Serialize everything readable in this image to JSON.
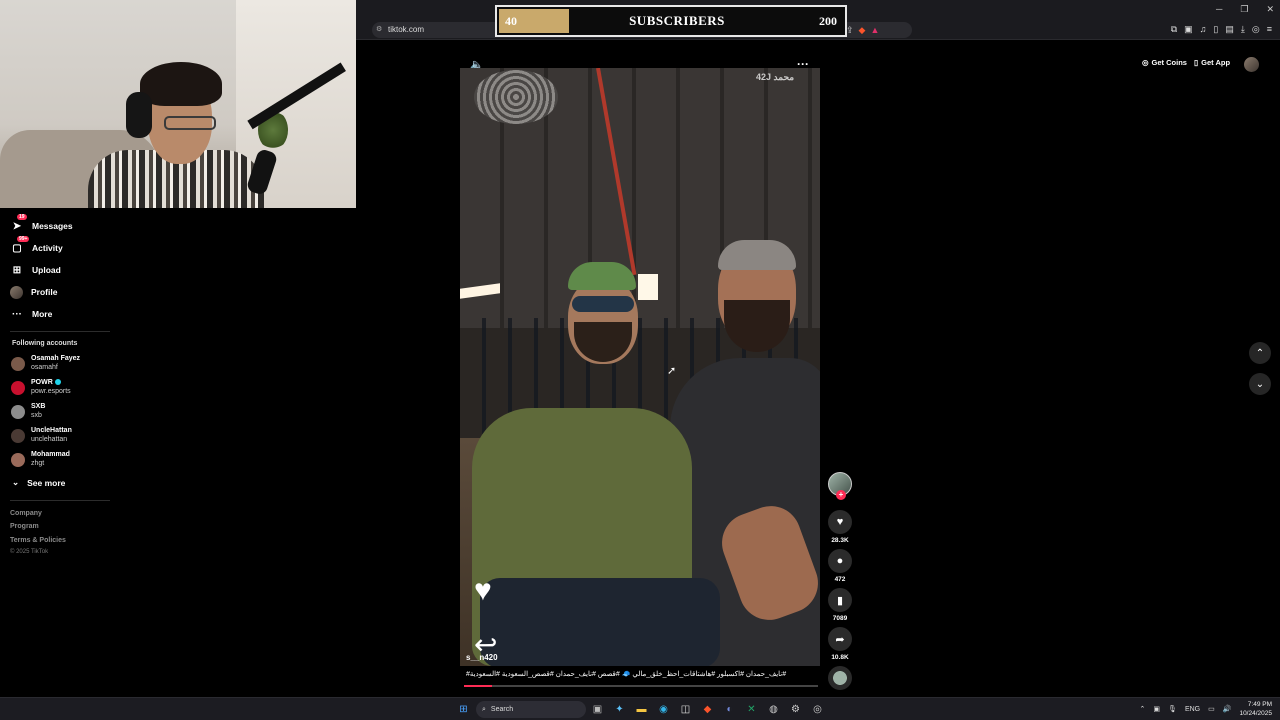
{
  "browser": {
    "url": "tiktok.com"
  },
  "subscriber_goal": {
    "current": "40",
    "label": "SUBSCRIBERS",
    "goal": "200",
    "progress_fraction": 0.2,
    "fill_color": "#c9a96b"
  },
  "sidebar": {
    "nav": [
      {
        "label": "Messages",
        "icon": "paper-plane-icon",
        "badge": "19"
      },
      {
        "label": "Activity",
        "icon": "inbox-icon",
        "badge": "99+"
      },
      {
        "label": "Upload",
        "icon": "plus-square-icon"
      },
      {
        "label": "Profile",
        "icon": "avatar"
      },
      {
        "label": "More",
        "icon": "ellipsis-icon"
      }
    ],
    "following_title": "Following accounts",
    "following": [
      {
        "name": "Osamah Fayez",
        "handle": "osamahf",
        "color": "#7a5a4a"
      },
      {
        "name": "POWR",
        "handle": "powr.esports",
        "verified": true,
        "color": "#c8102e"
      },
      {
        "name": "SXB",
        "handle": "sxb",
        "color": "#8c8c8c"
      },
      {
        "name": "UncleHattan",
        "handle": "unclehattan",
        "color": "#4a3a34"
      },
      {
        "name": "Mohammad",
        "handle": "zhgt",
        "color": "#9a6a5a"
      }
    ],
    "see_more": "See more",
    "footer": [
      "Company",
      "Program",
      "Terms & Policies"
    ],
    "copyright": "© 2025 TikTok"
  },
  "header": {
    "get_coins": "Get Coins",
    "get_app": "Get App"
  },
  "video": {
    "watermark": "42J محمد",
    "author": "s__n420",
    "caption": "#نايف_حمدان #اكسبلور #هاشتاقات_احظ_خلق_مالي 🧢 #قصص #نايف_حمدان #قصص_السعودية #السعودية#",
    "progress_fraction": 0.08
  },
  "actions": {
    "likes": "28.3K",
    "comments": "472",
    "saves": "7089",
    "shares": "10.8K"
  },
  "taskbar": {
    "search_placeholder": "Search",
    "language": "ENG",
    "time": "7:49 PM",
    "date": "10/24/2025"
  }
}
